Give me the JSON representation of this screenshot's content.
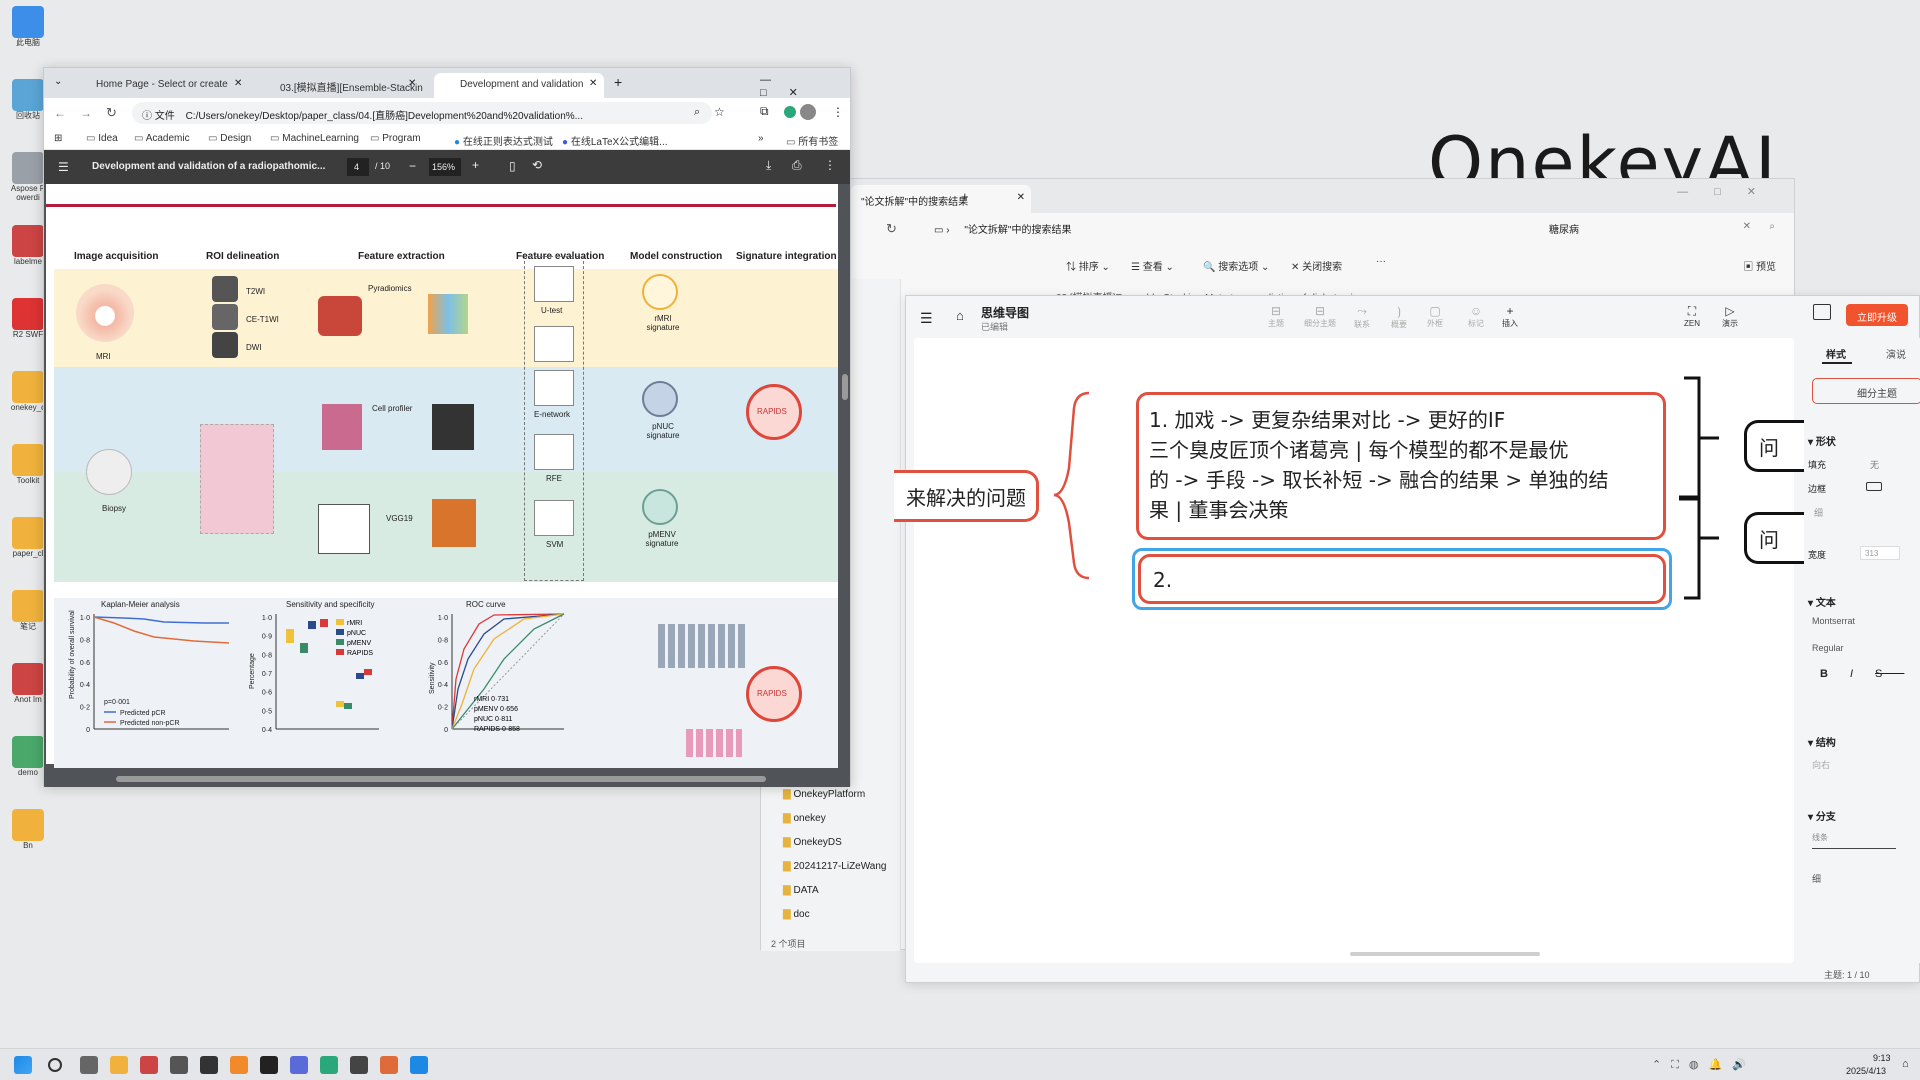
{
  "desktop": {
    "icons": [
      "此电脑",
      "回收站",
      "Aspose Powerdi",
      "labelme",
      "R2 SWF",
      "onekey_c",
      "Toolkit",
      "paper_cl",
      "笔记",
      "Anot Im",
      "demo",
      "Bn"
    ],
    "brand_text": "OnekeyAI"
  },
  "explorer": {
    "tab_title": "\"论文拆解\"中的搜索结果",
    "path": "\"论文拆解\"中的搜索结果",
    "search_value": "糖尿病",
    "toolbar": {
      "sort": "排序",
      "view": "查看",
      "search_options": "搜索选项",
      "close_search": "关闭搜索",
      "more": "···",
      "preview": "预览"
    },
    "result_snippet": "03.[模拟直播]Ensemble-Stacking-Meta-tree-prediction-of-diabetes-i",
    "folders": [
      "OnekeyPlatform",
      "onekey",
      "OnekeyDS",
      "20241217-LiZeWang",
      "DATA",
      "doc"
    ],
    "status": "2 个项目"
  },
  "browser": {
    "tabs": [
      {
        "title": "Home Page - Select or create"
      },
      {
        "title": "03.[模拟直播][Ensemble-Stackin"
      },
      {
        "title": "Development and validation"
      }
    ],
    "address_label": "文件",
    "url": "C:/Users/onekey/Desktop/paper_class/04.[直肠癌]Development%20and%20validation%...",
    "bookmarks": [
      "Idea",
      "Academic",
      "Design",
      "MachineLearning",
      "Program",
      "在线正则表达式测试",
      "在线LaTeX公式编辑...",
      "所有书签"
    ],
    "pdf": {
      "title": "Development and validation of a radiopathomic...",
      "page": "4",
      "total": "/ 10",
      "zoom": "156%",
      "headers": [
        "Image acquisition",
        "ROI delineation",
        "Feature extraction",
        "Feature evaluation",
        "Model construction",
        "Signature integration"
      ],
      "labels": {
        "mri": "MRI",
        "biopsy": "Biopsy",
        "t2wi": "T2WI",
        "ce": "CE-T1WI",
        "dwi": "DWI",
        "pyradiomics": "Pyradiomics",
        "cellprofiler": "Cell profiler",
        "vgg": "VGG19",
        "utest": "U-test",
        "enet": "E-network",
        "rfe": "RFE",
        "svm": "SVM",
        "rmri": "rMRI signature",
        "pnuc": "pNUC signature",
        "pmenv": "pMENV signature",
        "rapids": "RAPIDS"
      },
      "bottom": {
        "km": "Kaplan-Meier analysis",
        "km_ylabel": "Probability of overall survival",
        "km_p": "p=0·001",
        "km_legend": [
          "Predicted pCR",
          "Predicted non-pCR"
        ],
        "km_ticks": [
          "1·0",
          "0·8",
          "0·6",
          "0·4",
          "0·2",
          "0"
        ],
        "sens": "Sensitivity and specificity",
        "sens_ylabel": "Percentage",
        "sens_ticks": [
          "1·0",
          "0·9",
          "0·8",
          "0·7",
          "0·6",
          "0·5",
          "0·4"
        ],
        "sens_legend": [
          "rMRI",
          "pNUC",
          "pMENV",
          "RAPIDS"
        ],
        "roc": "ROC curve",
        "roc_ylabel": "Sensitivity",
        "roc_ticks": [
          "1·0",
          "0·8",
          "0·6",
          "0·4",
          "0·2",
          "0"
        ],
        "roc_legend": [
          "rMRI 0·731",
          "pMENV 0·656",
          "pNUC 0·811",
          "RAPIDS 0·858"
        ],
        "rapids": "RAPIDS"
      }
    }
  },
  "mindmap": {
    "title": "思维导图",
    "subtitle": "已编辑",
    "tools": [
      "主题",
      "细分主题",
      "联系",
      "概要",
      "外框",
      "标记",
      "插入",
      "ZEN",
      "演示"
    ],
    "upgrade": "立即升级",
    "tabs": [
      "样式",
      "演说"
    ],
    "left_node": "来解决的问题",
    "node1": [
      "1. 加戏 -> 更复杂结果对比 -> 更好的IF",
      "三个臭皮匠顶个诸葛亮 | 每个模型的都不是最优",
      "的 -> 手段 -> 取长补短 -> 融合的结果 > 单独的结",
      "果 | 董事会决策"
    ],
    "node2": "2.",
    "right_nodes": [
      "问",
      "问"
    ],
    "panel": {
      "subtopic": "细分主题",
      "shape": "形状",
      "fill": "填充",
      "fill_val": "无",
      "border": "边框",
      "thin": "细",
      "width": "宽度",
      "width_val": "313",
      "text": "文本",
      "font": "Montserrat",
      "weight": "Regular",
      "structure": "结构",
      "direction": "向右",
      "branch": "分支",
      "line": "线条",
      "line_val": "细"
    },
    "status": "主题: 1 / 10"
  },
  "taskbar": {
    "time": "9:13",
    "date": "2025/4/13"
  }
}
